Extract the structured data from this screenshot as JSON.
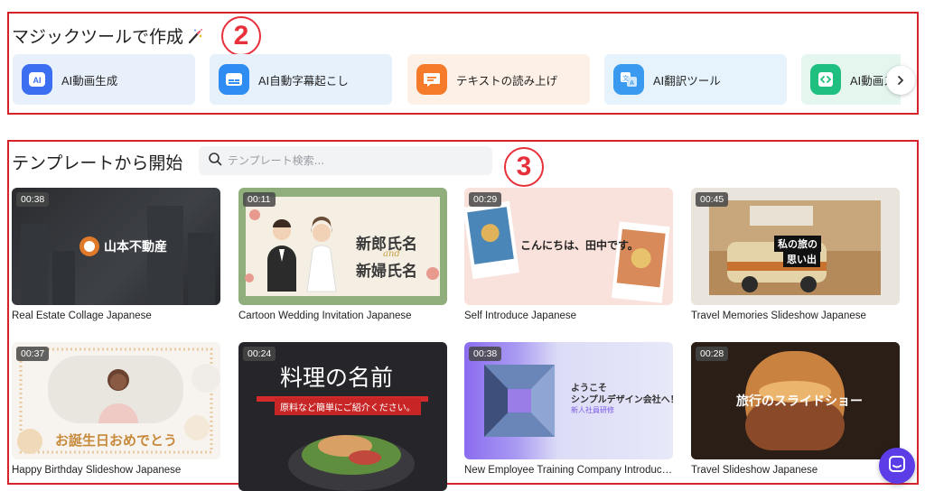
{
  "magic_tools": {
    "title": "マジックツールで作成",
    "badge": "2",
    "items": [
      {
        "label": "AI動画生成",
        "icon": "ai-video-icon",
        "bg": "#e8f0fb",
        "icon_bg": "#3b6ef0"
      },
      {
        "label": "AI自動字幕起こし",
        "icon": "subtitle-icon",
        "bg": "#e6f1fc",
        "icon_bg": "#2f8cf2"
      },
      {
        "label": "テキストの読み上げ",
        "icon": "speech-icon",
        "bg": "#fdf0e6",
        "icon_bg": "#f57b2a"
      },
      {
        "label": "AI翻訳ツール",
        "icon": "translate-icon",
        "bg": "#e6f3fc",
        "icon_bg": "#3a9af0"
      },
      {
        "label": "AI動画ス",
        "icon": "code-icon",
        "bg": "#e5f6ef",
        "icon_bg": "#1fbf7f"
      }
    ]
  },
  "templates": {
    "title": "テンプレートから開始",
    "badge": "3",
    "search_placeholder": "テンプレート検索...",
    "items": [
      {
        "duration": "00:38",
        "title": "Real Estate Collage Japanese",
        "overlay": "山本不動産"
      },
      {
        "duration": "00:11",
        "title": "Cartoon Wedding Invitation Japanese",
        "overlay_1": "新郎氏名",
        "overlay_and": "and",
        "overlay_2": "新婦氏名"
      },
      {
        "duration": "00:29",
        "title": "Self Introduce Japanese",
        "overlay": "こんにちは、田中です。"
      },
      {
        "duration": "00:45",
        "title": "Travel Memories Slideshow Japanese",
        "overlay_1": "私の旅の",
        "overlay_2": "思い出"
      },
      {
        "duration": "00:37",
        "title": "Happy Birthday Slideshow Japanese",
        "overlay": "お誕生日おめでとう"
      },
      {
        "duration": "00:24",
        "title": "",
        "overlay": "料理の名前",
        "overlay_sub": "原料など簡単にご紹介ください。"
      },
      {
        "duration": "00:38",
        "title": "New Employee Training Company Introducti...",
        "overlay_1": "ようこそ",
        "overlay_2": "シンプルデザイン会社へ！",
        "overlay_3": "新人社員研修"
      },
      {
        "duration": "00:28",
        "title": "Travel Slideshow Japanese",
        "overlay": "旅行のスライドショー"
      }
    ]
  },
  "colors": {
    "annotation": "#d6232b",
    "chat": "#5b3ce6"
  }
}
